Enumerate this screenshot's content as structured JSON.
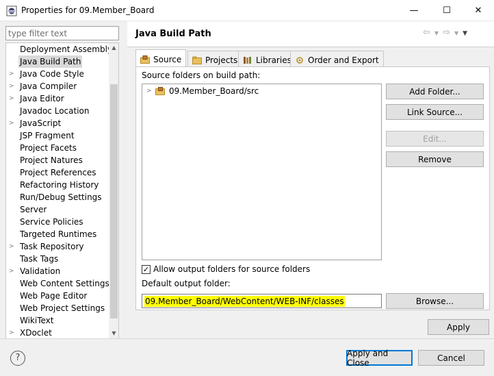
{
  "window": {
    "title": "Properties for 09.Member_Board",
    "minimize_glyph": "—",
    "maximize_glyph": "☐",
    "close_glyph": "✕"
  },
  "filter": {
    "placeholder": "type filter text"
  },
  "tree": {
    "items": [
      {
        "label": "Deployment Assembly",
        "expandable": false,
        "selected": false
      },
      {
        "label": "Java Build Path",
        "expandable": false,
        "selected": true
      },
      {
        "label": "Java Code Style",
        "expandable": true,
        "selected": false
      },
      {
        "label": "Java Compiler",
        "expandable": true,
        "selected": false
      },
      {
        "label": "Java Editor",
        "expandable": true,
        "selected": false
      },
      {
        "label": "Javadoc Location",
        "expandable": false,
        "selected": false
      },
      {
        "label": "JavaScript",
        "expandable": true,
        "selected": false
      },
      {
        "label": "JSP Fragment",
        "expandable": false,
        "selected": false
      },
      {
        "label": "Project Facets",
        "expandable": false,
        "selected": false
      },
      {
        "label": "Project Natures",
        "expandable": false,
        "selected": false
      },
      {
        "label": "Project References",
        "expandable": false,
        "selected": false
      },
      {
        "label": "Refactoring History",
        "expandable": false,
        "selected": false
      },
      {
        "label": "Run/Debug Settings",
        "expandable": false,
        "selected": false
      },
      {
        "label": "Server",
        "expandable": false,
        "selected": false
      },
      {
        "label": "Service Policies",
        "expandable": false,
        "selected": false
      },
      {
        "label": "Targeted Runtimes",
        "expandable": false,
        "selected": false
      },
      {
        "label": "Task Repository",
        "expandable": true,
        "selected": false
      },
      {
        "label": "Task Tags",
        "expandable": false,
        "selected": false
      },
      {
        "label": "Validation",
        "expandable": true,
        "selected": false
      },
      {
        "label": "Web Content Settings",
        "expandable": false,
        "selected": false
      },
      {
        "label": "Web Page Editor",
        "expandable": false,
        "selected": false
      },
      {
        "label": "Web Project Settings",
        "expandable": false,
        "selected": false
      },
      {
        "label": "WikiText",
        "expandable": false,
        "selected": false
      },
      {
        "label": "XDoclet",
        "expandable": true,
        "selected": false
      }
    ]
  },
  "page": {
    "title": "Java Build Path"
  },
  "tabs": [
    {
      "label": "Source",
      "icon": "source-folder-icon",
      "active": true
    },
    {
      "label": "Projects",
      "icon": "projects-icon",
      "active": false
    },
    {
      "label": "Libraries",
      "icon": "libraries-icon",
      "active": false
    },
    {
      "label": "Order and Export",
      "icon": "order-export-icon",
      "active": false
    }
  ],
  "source": {
    "label": "Source folders on build path:",
    "folders": [
      "09.Member_Board/src"
    ],
    "buttons": {
      "add_folder": "Add Folder...",
      "link_source": "Link Source...",
      "edit": "Edit...",
      "remove": "Remove",
      "browse": "Browse..."
    },
    "allow_output_label": "Allow output folders for source folders",
    "allow_output_checked": true,
    "output_label": "Default output folder:",
    "output_value": "09.Member_Board/WebContent/WEB-INF/classes",
    "highlight_color": "#ffff00"
  },
  "actions": {
    "apply": "Apply",
    "apply_close": "Apply and Close",
    "cancel": "Cancel",
    "help": "?"
  },
  "colors": {
    "accent": "#0078d7",
    "selection": "#d9d9d9"
  }
}
